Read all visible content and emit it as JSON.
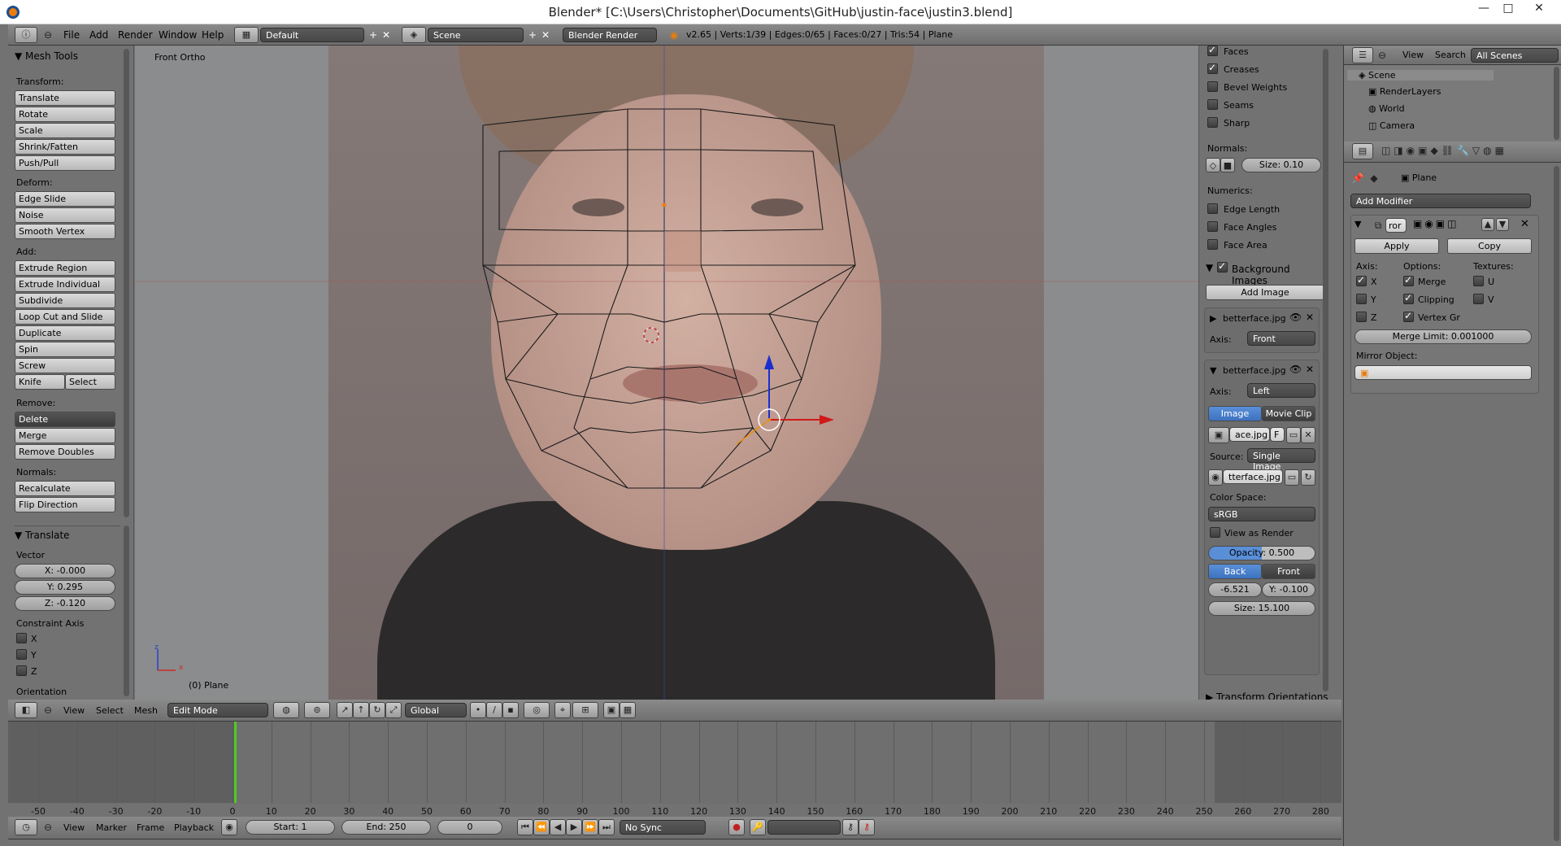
{
  "window": {
    "title": "Blender* [C:\\Users\\Christopher\\Documents\\GitHub\\justin-face\\justin3.blend]",
    "minimize": "—",
    "maximize": "□",
    "close": "✕"
  },
  "info_header": {
    "menus": [
      "File",
      "Add",
      "Render",
      "Window",
      "Help"
    ],
    "layout": "Default",
    "scene": "Scene",
    "engine": "Blender Render",
    "stats": "v2.65 | Verts:1/39 | Edges:0/65 | Faces:0/27 | Tris:54 | Plane"
  },
  "tool_shelf": {
    "title": "Mesh Tools",
    "transform_label": "Transform:",
    "transform": [
      "Translate",
      "Rotate",
      "Scale",
      "Shrink/Fatten",
      "Push/Pull"
    ],
    "deform_label": "Deform:",
    "deform": [
      "Edge Slide",
      "Noise",
      "Smooth Vertex"
    ],
    "add_label": "Add:",
    "add": [
      "Extrude Region",
      "Extrude Individual",
      "Subdivide",
      "Loop Cut and Slide",
      "Duplicate",
      "Spin",
      "Screw"
    ],
    "knife": "Knife",
    "select": "Select",
    "remove_label": "Remove:",
    "delete": "Delete",
    "remove": [
      "Merge",
      "Remove Doubles"
    ],
    "normals_label": "Normals:",
    "normals": [
      "Recalculate",
      "Flip Direction"
    ],
    "op_title": "Translate",
    "vector_label": "Vector",
    "x": "X: -0.000",
    "y": "Y: 0.295",
    "z": "Z: -0.120",
    "constraint_label": "Constraint Axis",
    "axes": [
      "X",
      "Y",
      "Z"
    ],
    "orientation_label": "Orientation"
  },
  "viewport": {
    "view_name": "Front Ortho",
    "object": "(0) Plane",
    "axis_z": "z",
    "axis_x": "x"
  },
  "n_panel": {
    "overlay_items": [
      {
        "label": "Faces",
        "checked": true
      },
      {
        "label": "Creases",
        "checked": true
      },
      {
        "label": "Bevel Weights",
        "checked": false
      },
      {
        "label": "Seams",
        "checked": false
      },
      {
        "label": "Sharp",
        "checked": false
      }
    ],
    "normals_label": "Normals:",
    "normals_size": "Size: 0.10",
    "numerics_label": "Numerics:",
    "numerics": [
      "Edge Length",
      "Face Angles",
      "Face Area"
    ],
    "bg_title": "Background Images",
    "add_image": "Add Image",
    "img1": {
      "name": "betterface.jpg",
      "axis_label": "Axis:",
      "axis": "Front"
    },
    "img2": {
      "name": "betterface.jpg",
      "axis_label": "Axis:",
      "axis": "Left",
      "tab_image": "Image",
      "tab_clip": "Movie Clip",
      "file": "ace.jpg",
      "file_f": "F",
      "source_label": "Source:",
      "source": "Single Image",
      "path": "tterface.jpg",
      "colorspace_label": "Color Space:",
      "colorspace": "sRGB",
      "view_as_render": "View as Render",
      "opacity": "Opacity: 0.500",
      "back": "Back",
      "front": "Front",
      "x": "-6.521",
      "y": "Y: -0.100",
      "size": "Size: 15.100"
    },
    "transform_orientations": "Transform Orientations"
  },
  "outliner": {
    "view": "View",
    "search": "Search",
    "filter": "All Scenes",
    "rows": [
      "Scene",
      "RenderLayers",
      "World",
      "Camera"
    ]
  },
  "properties": {
    "object": "Plane",
    "add_modifier": "Add Modifier",
    "modifier_name": "ror",
    "apply": "Apply",
    "copy": "Copy",
    "axis_label": "Axis:",
    "options_label": "Options:",
    "textures_label": "Textures:",
    "axis": [
      {
        "label": "X",
        "checked": true
      },
      {
        "label": "Y",
        "checked": false
      },
      {
        "label": "Z",
        "checked": false
      }
    ],
    "options": [
      {
        "label": "Merge",
        "checked": true
      },
      {
        "label": "Clipping",
        "checked": true
      },
      {
        "label": "Vertex Gr",
        "checked": true
      }
    ],
    "textures": [
      {
        "label": "U",
        "checked": false
      },
      {
        "label": "V",
        "checked": false
      }
    ],
    "merge_limit": "Merge Limit: 0.001000",
    "mirror_object": "Mirror Object:"
  },
  "view3d_header": {
    "menus": [
      "View",
      "Select",
      "Mesh"
    ],
    "mode": "Edit Mode",
    "orientation": "Global"
  },
  "timeline": {
    "ticks": [
      "-50",
      "-40",
      "-30",
      "-20",
      "-10",
      "0",
      "10",
      "20",
      "30",
      "40",
      "50",
      "60",
      "70",
      "80",
      "90",
      "100",
      "110",
      "120",
      "130",
      "140",
      "150",
      "160",
      "170",
      "180",
      "190",
      "200",
      "210",
      "220",
      "230",
      "240",
      "250",
      "260",
      "270",
      "280"
    ],
    "menus": [
      "View",
      "Marker",
      "Frame",
      "Playback"
    ],
    "start": "Start: 1",
    "end": "End: 250",
    "current": "0",
    "sync": "No Sync"
  }
}
